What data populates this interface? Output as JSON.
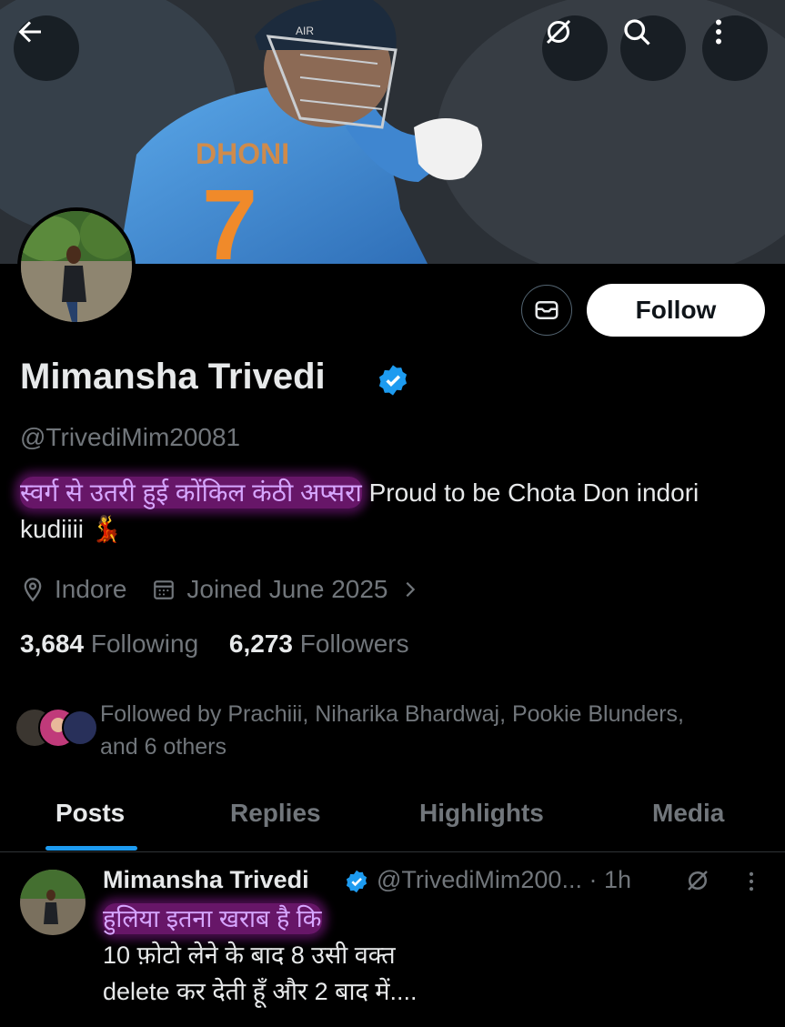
{
  "header": {
    "back_icon": "arrow-left-icon",
    "grok_icon": "grok-icon",
    "search_icon": "search-icon",
    "more_icon": "more-vertical-icon",
    "banner_text": "AIR"
  },
  "profile": {
    "name": "Mimansha Trivedi",
    "handle": "@TrivediMim20081",
    "bio_highlighted": "स्वर्ग से उतरी हुई कोंकिल कंठी अप्सरा",
    "bio_rest": " Proud to be Chota Don indori",
    "bio_line2": "kudiiii 💃",
    "location": "Indore",
    "joined": "Joined June 2025",
    "following_count": "3,684",
    "following_label": "Following",
    "followers_count": "6,273",
    "followers_label": "Followers",
    "followed_by": "Followed by Prachiii, Niharika Bhardwaj, Pookie Blunders,",
    "followed_by_more": "and 6 others"
  },
  "actions": {
    "follow_label": "Follow",
    "message_icon": "mail-icon"
  },
  "tabs": [
    {
      "label": "Posts",
      "active": true
    },
    {
      "label": "Replies",
      "active": false
    },
    {
      "label": "Highlights",
      "active": false
    },
    {
      "label": "Media",
      "active": false
    }
  ],
  "post": {
    "name": "Mimansha Trivedi",
    "handle_time": "@TrivediMim200... · 1h",
    "line1": "हुलिया इतना खराब है कि",
    "line2": "10 फ़ोटो लेने के बाद 8 उसी वक्त",
    "line3": "delete कर देती हूँ और 2 बाद में...."
  },
  "colors": {
    "accent": "#1d9bf0",
    "highlight": "#bc28be",
    "background": "#000000"
  }
}
